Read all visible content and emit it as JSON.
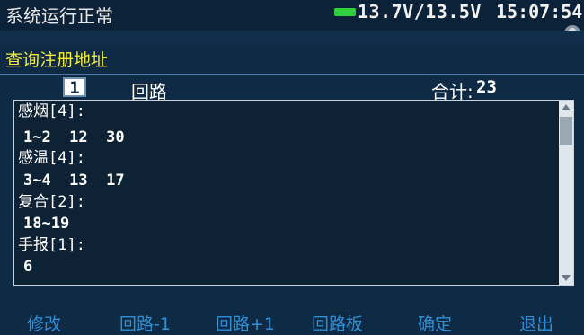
{
  "status": {
    "message": "系统运行正常",
    "voltage": "13.7V/13.5V",
    "time": "15:07:54",
    "battery_color": "#2fd23c"
  },
  "page": {
    "title": "查询注册地址",
    "title_color": "#f2ec3a"
  },
  "loop": {
    "number": "1",
    "label": "回路",
    "total_label": "合计:",
    "total_value": "23"
  },
  "registrations": [
    {
      "header": "感烟",
      "code": "[4]:",
      "values": "1~2  12  30"
    },
    {
      "header": "感温",
      "code": "[4]:",
      "values": "3~4  13  17"
    },
    {
      "header": "复合",
      "code": "[2]:",
      "values": "18~19"
    },
    {
      "header": "手报",
      "code": "[1]:",
      "values": "6"
    }
  ],
  "footer": {
    "keys": [
      "修改",
      "回路-1",
      "回路+1",
      "回路板",
      "确定",
      "退出"
    ],
    "key_color": "#2d8fd6"
  }
}
